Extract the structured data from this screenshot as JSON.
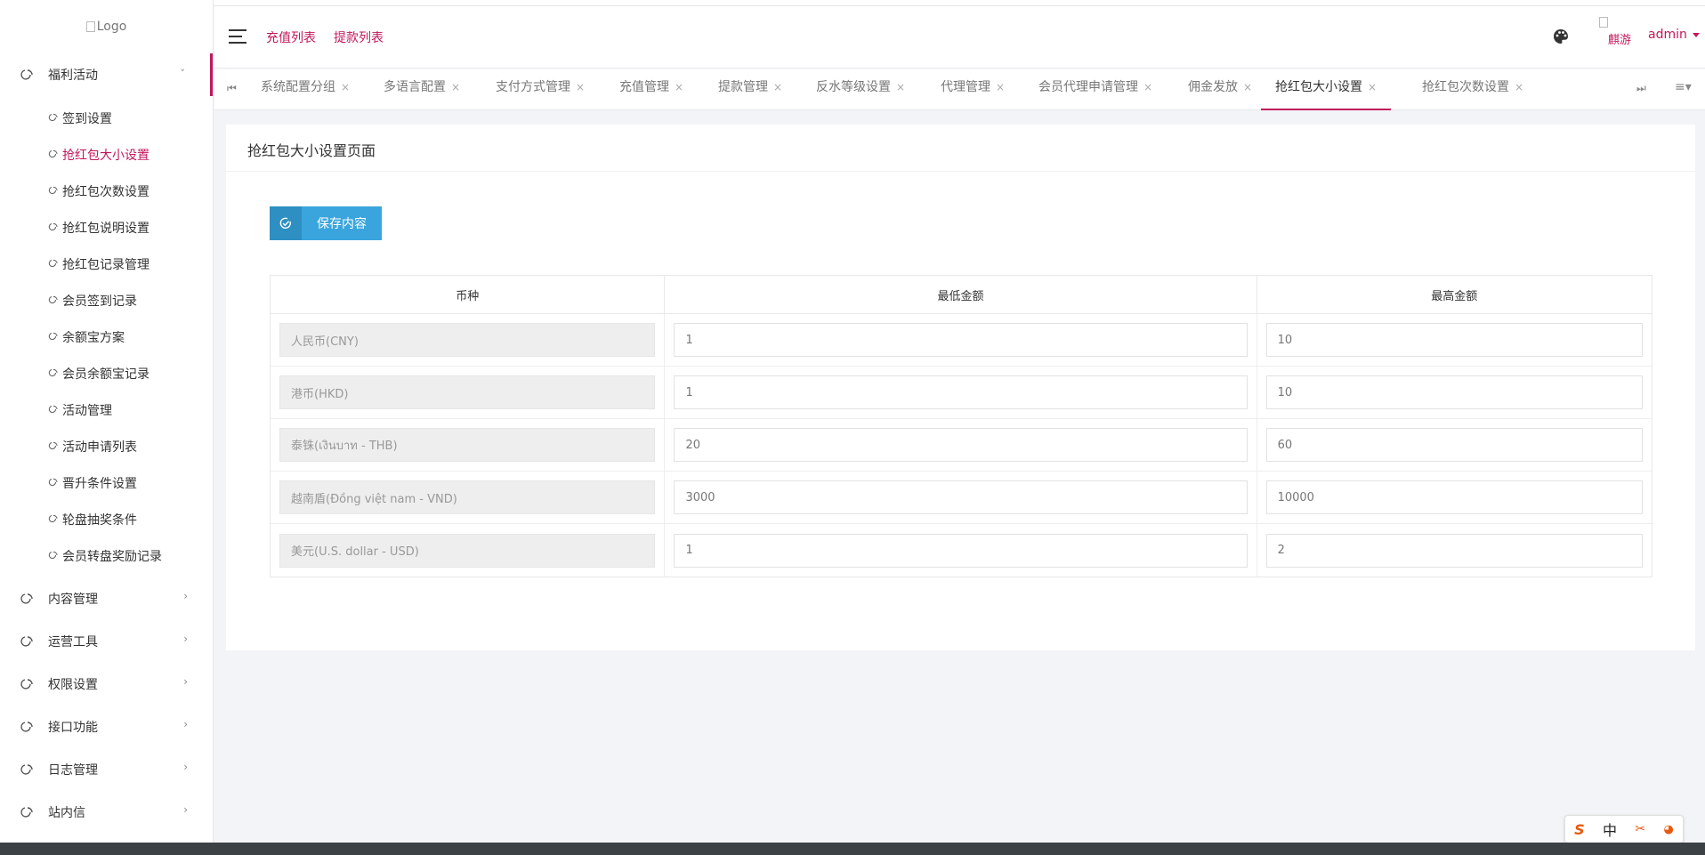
{
  "sidebar": {
    "logo_alt": "Logo",
    "open_group": {
      "label": "福利活动"
    },
    "sub_items": [
      {
        "label": "签到设置",
        "active": false
      },
      {
        "label": "抢红包大小设置",
        "active": true
      },
      {
        "label": "抢红包次数设置",
        "active": false
      },
      {
        "label": "抢红包说明设置",
        "active": false
      },
      {
        "label": "抢红包记录管理",
        "active": false
      },
      {
        "label": "会员签到记录",
        "active": false
      },
      {
        "label": "余额宝方案",
        "active": false
      },
      {
        "label": "会员余额宝记录",
        "active": false
      },
      {
        "label": "活动管理",
        "active": false
      },
      {
        "label": "活动申请列表",
        "active": false
      },
      {
        "label": "晋升条件设置",
        "active": false
      },
      {
        "label": "轮盘抽奖条件",
        "active": false
      },
      {
        "label": "会员转盘奖励记录",
        "active": false
      }
    ],
    "groups": [
      {
        "label": "内容管理"
      },
      {
        "label": "运营工具"
      },
      {
        "label": "权限设置"
      },
      {
        "label": "接口功能"
      },
      {
        "label": "日志管理"
      },
      {
        "label": "站内信"
      }
    ]
  },
  "header": {
    "links": [
      "充值列表",
      "提款列表"
    ],
    "avatar_alt": "麒游",
    "user": "admin"
  },
  "tabs": [
    {
      "label": "系统配置分组",
      "active": false
    },
    {
      "label": "多语言配置",
      "active": false
    },
    {
      "label": "支付方式管理",
      "active": false
    },
    {
      "label": "充值管理",
      "active": false
    },
    {
      "label": "提款管理",
      "active": false
    },
    {
      "label": "反水等级设置",
      "active": false
    },
    {
      "label": "代理管理",
      "active": false
    },
    {
      "label": "会员代理申请管理",
      "active": false
    },
    {
      "label": "佣金发放",
      "active": false
    },
    {
      "label": "抢红包大小设置",
      "active": true
    },
    {
      "label": "抢红包次数设置",
      "active": false
    }
  ],
  "tab_close": "×",
  "card": {
    "title": "抢红包大小设置页面",
    "save_label": "保存内容"
  },
  "table": {
    "headers": [
      "币种",
      "最低金额",
      "最高金额"
    ],
    "rows": [
      {
        "currency": "人民币(CNY)",
        "min": "1",
        "max": "10"
      },
      {
        "currency": "港币(HKD)",
        "min": "1",
        "max": "10"
      },
      {
        "currency": "泰铢(เงินบาท - THB)",
        "min": "20",
        "max": "60"
      },
      {
        "currency": "越南盾(Đồng việt nam - VND)",
        "min": "3000",
        "max": "10000"
      },
      {
        "currency": "美元(U.S. dollar - USD)",
        "min": "1",
        "max": "2"
      }
    ]
  },
  "ime": {
    "lang": "中"
  },
  "colors": {
    "accent": "#c2185b",
    "button": "#3aa5dc"
  }
}
